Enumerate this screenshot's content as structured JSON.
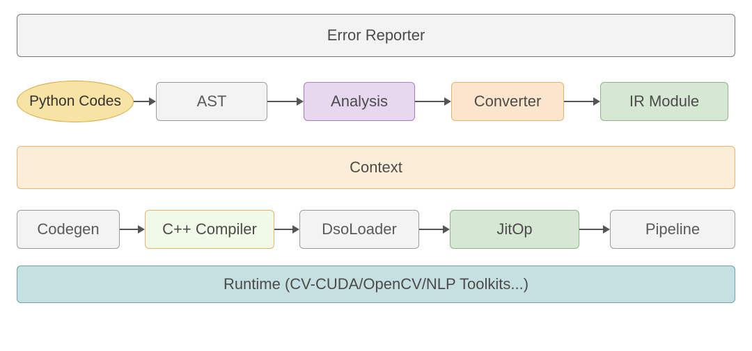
{
  "error_reporter": {
    "label": "Error Reporter"
  },
  "row1": {
    "python_codes": "Python Codes",
    "ast": "AST",
    "analysis": "Analysis",
    "converter": "Converter",
    "ir_module": "IR Module"
  },
  "context": {
    "label": "Context"
  },
  "row2": {
    "codegen": "Codegen",
    "cpp_compiler": "C++ Compiler",
    "dso_loader": "DsoLoader",
    "jitop": "JitOp",
    "pipeline": "Pipeline"
  },
  "runtime": {
    "label": "Runtime (CV-CUDA/OpenCV/NLP Toolkits...)"
  }
}
